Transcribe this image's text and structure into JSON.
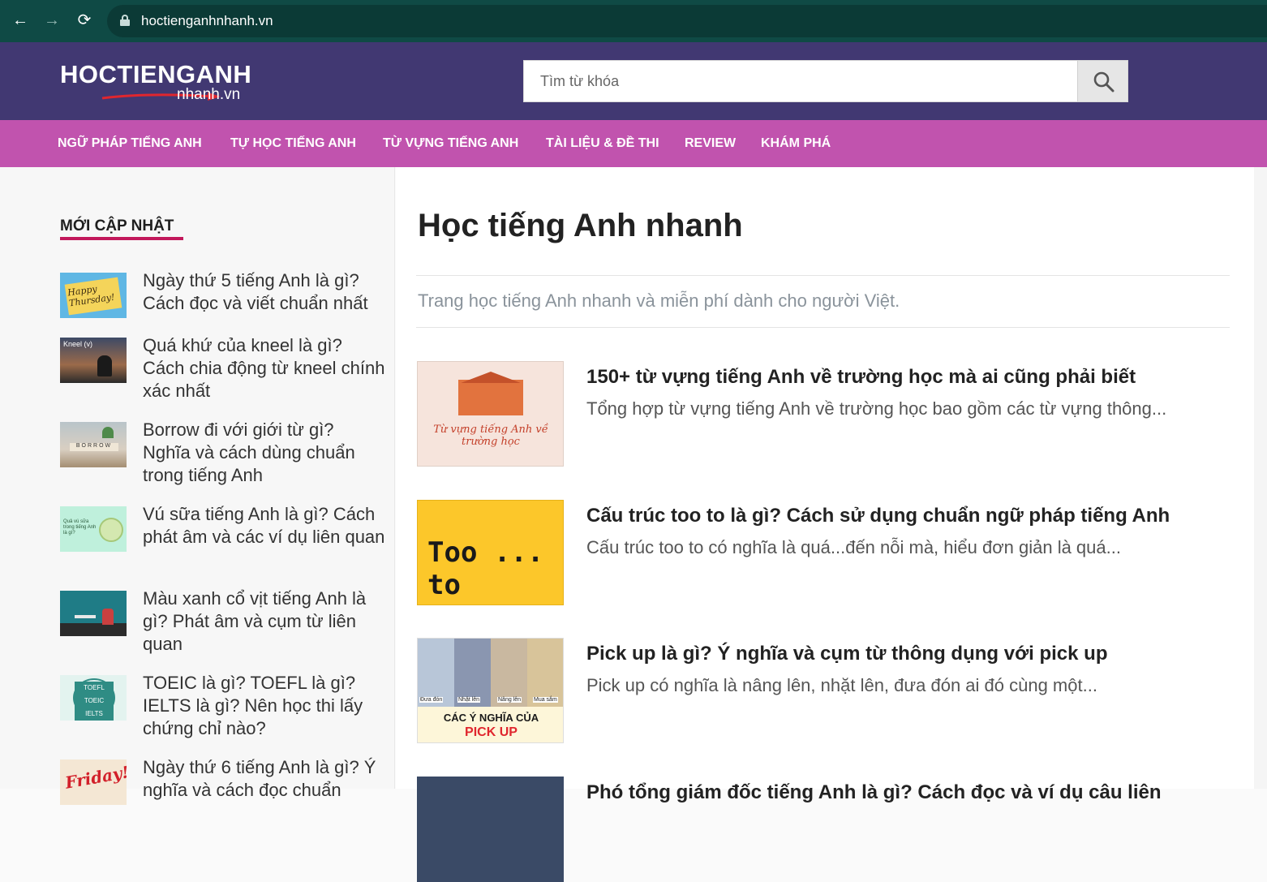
{
  "browser": {
    "url": "hoctienganhnhanh.vn",
    "back_icon": "←",
    "forward_icon": "→",
    "reload_icon": "⟳"
  },
  "header": {
    "logo_top": "HOCTIENGANH",
    "logo_bottom": "nhanh.vn",
    "search_placeholder": "Tìm từ khóa"
  },
  "menu": {
    "items": [
      {
        "label": "NGỮ PHÁP TIẾNG ANH"
      },
      {
        "label": "TỰ HỌC TIẾNG ANH"
      },
      {
        "label": "TỪ VỰNG TIẾNG ANH"
      },
      {
        "label": "TÀI LIỆU & ĐỀ THI"
      },
      {
        "label": "REVIEW"
      },
      {
        "label": "KHÁM PHÁ"
      }
    ]
  },
  "sidebar": {
    "title": "MỚI CẬP NHẬT",
    "items": [
      {
        "title": "Ngày thứ 5 tiếng Anh là gì? Cách đọc và viết chuẩn nhất",
        "thumb_text": "Happy Thursday!"
      },
      {
        "title": "Quá khứ của kneel là gì? Cách chia động từ kneel chính xác nhất",
        "thumb_text": "Kneel (v)"
      },
      {
        "title": "Borrow đi với giới từ gì? Nghĩa và cách dùng chuẩn trong tiếng Anh",
        "thumb_text": "BORROW"
      },
      {
        "title": "Vú sữa tiếng Anh là gì? Cách phát âm và các ví dụ liên quan",
        "thumb_text": "Quả vú sữa trong tiếng Anh là gì?"
      },
      {
        "title": "Màu xanh cổ vịt tiếng Anh là gì? Phát âm và cụm từ liên quan",
        "thumb_text": ""
      },
      {
        "title": "TOEIC là gì? TOEFL là gì? IELTS là gì? Nên học thi lấy chứng chỉ nào?",
        "thumb_text": "TOEFL TOEIC IELTS"
      },
      {
        "title": "Ngày thứ 6 tiếng Anh là gì? Ý nghĩa và cách đọc chuẩn",
        "thumb_text": "Friday!"
      }
    ]
  },
  "main": {
    "title": "Học tiếng Anh nhanh",
    "description": "Trang học tiếng Anh nhanh và miễn phí dành cho người Việt.",
    "posts": [
      {
        "title": "150+ từ vựng tiếng Anh về trường học mà ai cũng phải biết",
        "excerpt": "Tổng hợp từ vựng tiếng Anh về trường học bao gồm các từ vựng thông...",
        "thumb_text": "Từ vựng tiếng Anh về trường học"
      },
      {
        "title": "Cấu trúc too to là gì? Cách sử dụng chuẩn ngữ pháp tiếng Anh",
        "excerpt": "Cấu trúc too to có nghĩa là quá...đến nỗi mà, hiểu đơn giản là quá...",
        "thumb_text": "Too ... to"
      },
      {
        "title": "Pick up là gì? Ý nghĩa và cụm từ thông dụng với pick up",
        "excerpt": "Pick up có nghĩa là nâng lên, nhặt lên, đưa đón ai đó cùng một...",
        "thumb_text_1": "CÁC Ý NGHĨA CỦA",
        "thumb_text_2": "PICK UP",
        "thumb_labels": [
          "Đưa đón",
          "Nhặt lên",
          "Nâng lên",
          "Mua sắm"
        ]
      },
      {
        "title": "Phó tổng giám đốc tiếng Anh là gì? Cách đọc và ví dụ câu liên",
        "excerpt": "",
        "thumb_text": ""
      }
    ]
  },
  "colors": {
    "browser_bar": "#0f4a45",
    "header_bg": "#413872",
    "menu_bg": "#c153ae",
    "accent_underline": "#c2185b"
  },
  "icons": {
    "search": "search-icon",
    "lock": "lock-icon"
  }
}
